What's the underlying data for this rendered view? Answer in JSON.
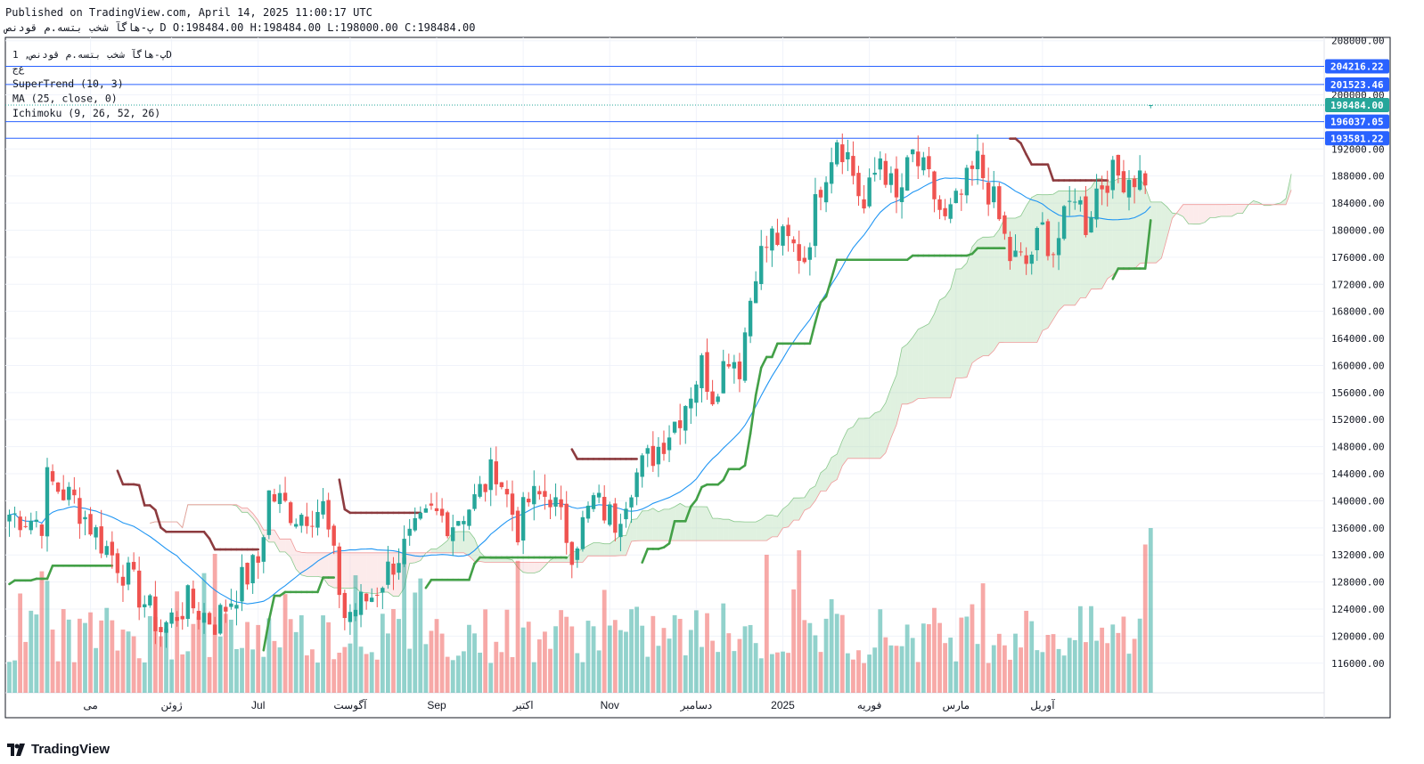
{
  "header": {
    "published": "Published on TradingView.com, April 14, 2025 11:00:17 UTC",
    "symbol": "پ-هاگآ شخب بتسه.م قودنص",
    "timeframe": "D",
    "ohlc": "O:198484.00 H:198484.00 L:198000.00 C:198484.00"
  },
  "legend": {
    "title": "پ-هاگآ شخب بتسه.م قودنص, 1D",
    "subtitle": "ﻉﺝ",
    "indicators": [
      "SuperTrend (10, 3)",
      "MA (25, close, 0)",
      "Ichimoku (9, 26, 52, 26)"
    ]
  },
  "colors": {
    "up": "#26a69a",
    "down": "#ef5350",
    "ma": "#2196f3",
    "supertrend_up": "#43a047",
    "supertrend_down": "#8d3b3f",
    "hline": "#2962ff",
    "cloud_up": "#a5d6a7",
    "cloud_down": "#f7c7c5",
    "last_price": "#26a69a"
  },
  "brand": "TradingView",
  "chart_data": {
    "type": "candlestick",
    "y_axis": {
      "ticks": [
        116000,
        120000,
        124000,
        128000,
        132000,
        136000,
        140000,
        144000,
        148000,
        152000,
        156000,
        160000,
        164000,
        168000,
        172000,
        176000,
        180000,
        184000,
        188000,
        192000,
        200000,
        208000
      ],
      "labels": [
        "116000.00",
        "120000.00",
        "124000.00",
        "128000.00",
        "132000.00",
        "136000.00",
        "140000.00",
        "144000.00",
        "148000.00",
        "152000.00",
        "156000.00",
        "160000.00",
        "164000.00",
        "168000.00",
        "172000.00",
        "176000.00",
        "180000.00",
        "184000.00",
        "188000.00",
        "192000.00",
        "200000.00",
        "208000.00"
      ]
    },
    "x_axis": {
      "labels": [
        "مى",
        "ژوئن",
        "Jul",
        "آگوست",
        "Sep",
        "اکتبر",
        "Nov",
        "دسامبر",
        "2025",
        "فوریه",
        "مارس",
        "آوریل"
      ],
      "label_bar_index": [
        15,
        30,
        46,
        63,
        79,
        95,
        111,
        127,
        143,
        159,
        175,
        191
      ]
    },
    "horizontal_lines": [
      {
        "value": 204216.22,
        "label": "204216.22"
      },
      {
        "value": 201523.46,
        "label": "201523.46"
      },
      {
        "value": 196037.05,
        "label": "196037.05"
      },
      {
        "value": 193581.22,
        "label": "193581.22"
      }
    ],
    "last_price": {
      "value": 198484.0,
      "label": "198484.00"
    },
    "bars_count": 212,
    "close_anchors": [
      [
        0,
        138000
      ],
      [
        6,
        137000
      ],
      [
        7,
        143000
      ],
      [
        12,
        140000
      ],
      [
        17,
        134000
      ],
      [
        20,
        131000
      ],
      [
        25,
        125000
      ],
      [
        28,
        121000
      ],
      [
        33,
        125000
      ],
      [
        38,
        122000
      ],
      [
        43,
        128000
      ],
      [
        46,
        131000
      ],
      [
        48,
        141000
      ],
      [
        53,
        138000
      ],
      [
        58,
        139000
      ],
      [
        60,
        131000
      ],
      [
        62,
        123000
      ],
      [
        67,
        126000
      ],
      [
        71,
        131000
      ],
      [
        75,
        135000
      ],
      [
        78,
        138000
      ],
      [
        82,
        137000
      ],
      [
        86,
        140000
      ],
      [
        90,
        145000
      ],
      [
        94,
        136000
      ],
      [
        96,
        140000
      ],
      [
        100,
        141000
      ],
      [
        104,
        133000
      ],
      [
        108,
        140000
      ],
      [
        112,
        137000
      ],
      [
        115,
        143000
      ],
      [
        118,
        146000
      ],
      [
        120,
        148000
      ],
      [
        124,
        153000
      ],
      [
        128,
        160000
      ],
      [
        130,
        156000
      ],
      [
        133,
        162000
      ],
      [
        135,
        160000
      ],
      [
        138,
        175000
      ],
      [
        141,
        179000
      ],
      [
        144,
        178000
      ],
      [
        147,
        176000
      ],
      [
        150,
        187000
      ],
      [
        153,
        194000
      ],
      [
        155,
        191000
      ],
      [
        158,
        183000
      ],
      [
        161,
        191000
      ],
      [
        164,
        184000
      ],
      [
        167,
        191000
      ],
      [
        170,
        187000
      ],
      [
        173,
        181000
      ],
      [
        176,
        185000
      ],
      [
        179,
        190000
      ],
      [
        182,
        184000
      ],
      [
        185,
        176000
      ],
      [
        188,
        175000
      ],
      [
        191,
        180000
      ],
      [
        193,
        177000
      ],
      [
        195,
        181000
      ],
      [
        197,
        186000
      ],
      [
        199,
        181000
      ],
      [
        201,
        186000
      ],
      [
        203,
        188000
      ]
    ],
    "volume_scale": [
      0,
      1
    ],
    "ma_period": 25,
    "supertrend_period": 10,
    "supertrend_multiplier": 3,
    "ichimoku": [
      9,
      26,
      52,
      26
    ]
  }
}
